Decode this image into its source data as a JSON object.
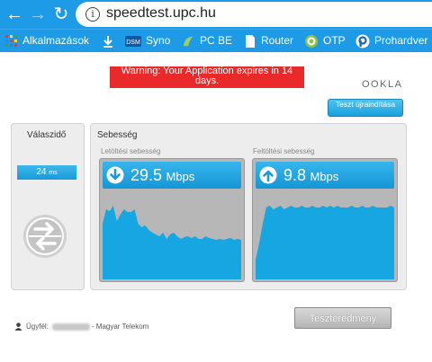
{
  "browser": {
    "url": "speedtest.upc.hu",
    "bookmarks": [
      {
        "label": "Alkalmazások",
        "icon": "apps-grid-icon"
      },
      {
        "label": "",
        "icon": "download-icon"
      },
      {
        "label": "Syno",
        "icon": "dsm-icon"
      },
      {
        "label": "PC BE",
        "icon": "pcbe-icon"
      },
      {
        "label": "Router",
        "icon": "page-icon"
      },
      {
        "label": "OTP",
        "icon": "otp-icon"
      },
      {
        "label": "Prohardver",
        "icon": "prohardver-icon"
      }
    ]
  },
  "page": {
    "warning": "Warning: Your Application expires in 14 days.",
    "ookla_logo": "OOKLA",
    "restart_button": "Teszt újraindítása",
    "response_title": "Válaszidő",
    "ping_value": "24",
    "ping_unit": "ms",
    "speed_title": "Sebesség",
    "download_label": "Letöltési sebesség",
    "upload_label": "Feltöltési sebesség",
    "download_value": "29.5",
    "download_unit": "Mbps",
    "upload_value": "9.8",
    "upload_unit": "Mbps",
    "client_prefix": "Ügyfél:",
    "client_isp": "- Magyar Telekom",
    "result_button": "Teszteredmény",
    "colors": {
      "accent": "#1e9be6",
      "warning": "#ea2a2a",
      "graph": "#16a7e3"
    }
  },
  "chart_data": [
    {
      "type": "area",
      "title": "Letöltési sebesség",
      "values": [
        0.38,
        0.22,
        0.24,
        0.18,
        0.35,
        0.28,
        0.22,
        0.25,
        0.25,
        0.22,
        0.38,
        0.42,
        0.4,
        0.45,
        0.48,
        0.5,
        0.52,
        0.48,
        0.55,
        0.5,
        0.48,
        0.52,
        0.55,
        0.53,
        0.52,
        0.54,
        0.52,
        0.55,
        0.55,
        0.52,
        0.54,
        0.55,
        0.56,
        0.55,
        0.56,
        0.55,
        0.54,
        0.56,
        0.55,
        0.56
      ]
    },
    {
      "type": "area",
      "title": "Feltöltési sebesség",
      "values": [
        0.78,
        0.6,
        0.38,
        0.2,
        0.18,
        0.22,
        0.2,
        0.18,
        0.22,
        0.2,
        0.18,
        0.2,
        0.2,
        0.18,
        0.2,
        0.2,
        0.18,
        0.2,
        0.2,
        0.18,
        0.2,
        0.18,
        0.2,
        0.18,
        0.2,
        0.2,
        0.2,
        0.18,
        0.2,
        0.2,
        0.18,
        0.2,
        0.2,
        0.18,
        0.2,
        0.2,
        0.2,
        0.2,
        0.18,
        0.2
      ]
    }
  ]
}
